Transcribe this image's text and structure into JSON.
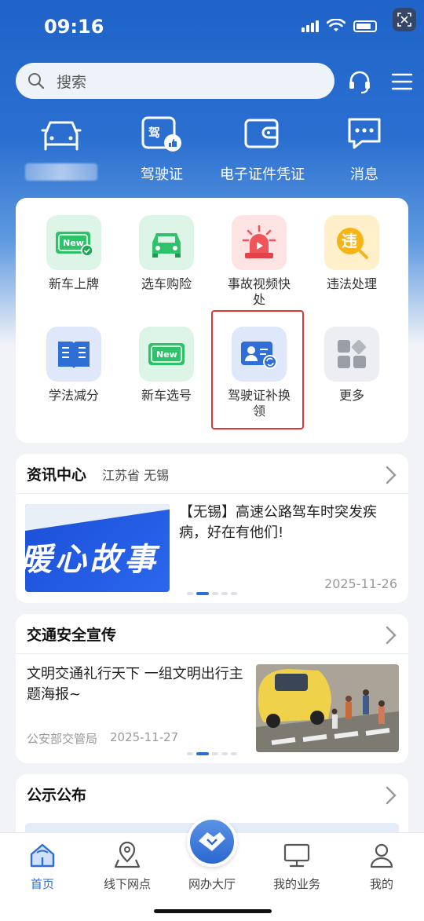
{
  "status_bar": {
    "time": "09:16"
  },
  "search": {
    "placeholder": "搜索"
  },
  "quick_actions": [
    {
      "label": "",
      "icon": "car-icon"
    },
    {
      "label": "驾驶证",
      "icon": "license-icon"
    },
    {
      "label": "电子证件凭证",
      "icon": "wallet-icon"
    },
    {
      "label": "消息",
      "icon": "message-icon"
    }
  ],
  "services": [
    {
      "label": "新车上牌",
      "icon": "new-plate-icon"
    },
    {
      "label": "选车购险",
      "icon": "car-insurance-icon"
    },
    {
      "label": "事故视频快处",
      "icon": "accident-video-icon"
    },
    {
      "label": "违法处理",
      "icon": "violation-icon"
    },
    {
      "label": "学法减分",
      "icon": "book-icon"
    },
    {
      "label": "新车选号",
      "icon": "new-number-icon"
    },
    {
      "label": "驾驶证补换领",
      "icon": "license-renew-icon"
    },
    {
      "label": "更多",
      "icon": "more-grid-icon"
    }
  ],
  "news": {
    "title": "资讯中心",
    "region": "江苏省 无锡",
    "image_text": "暖心故事",
    "headline": "【无锡】高速公路驾车时突发疾病，好在有他们!",
    "date": "2025-11-26"
  },
  "safety": {
    "title": "交通安全宣传",
    "headline": "文明交通礼行天下 一组文明出行主题海报~",
    "source": "公安部交管局",
    "date": "2025-11-27"
  },
  "notice": {
    "title": "公示公布"
  },
  "nav": [
    {
      "label": "首页",
      "icon": "home-icon"
    },
    {
      "label": "线下网点",
      "icon": "map-pin-icon"
    },
    {
      "label": "网办大厅",
      "icon": "handshake-icon"
    },
    {
      "label": "我的业务",
      "icon": "monitor-icon"
    },
    {
      "label": "我的",
      "icon": "user-icon"
    }
  ],
  "colors": {
    "primary": "#2f6fd5",
    "highlight": "#d9373a"
  }
}
